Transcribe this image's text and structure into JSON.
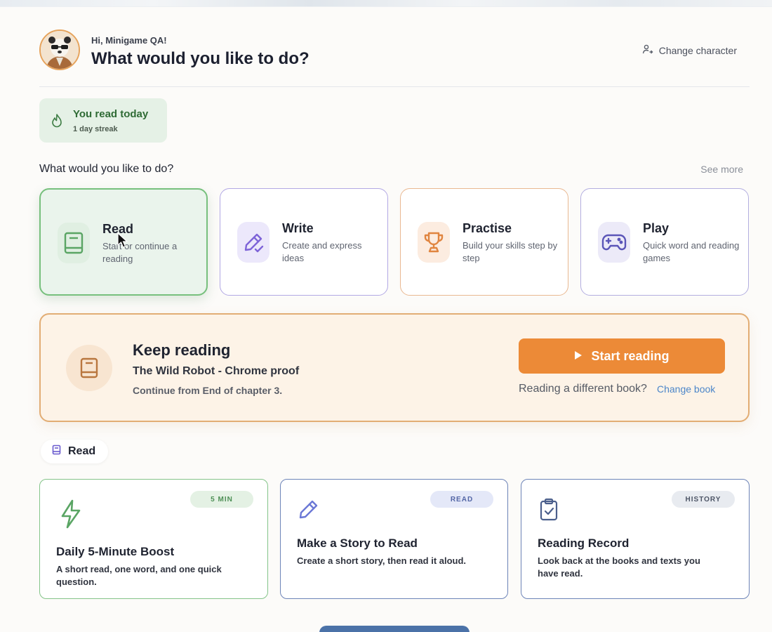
{
  "header": {
    "greeting": "Hi, Minigame QA!",
    "title": "What would you like to do?",
    "change_character": "Change character"
  },
  "streak": {
    "title": "You read today",
    "subtitle": "1 day streak"
  },
  "activities": {
    "section_title": "What would you like to do?",
    "see_more": "See more",
    "items": [
      {
        "title": "Read",
        "desc": "Start or continue a reading",
        "icon": "book-icon",
        "color": "#5aa564"
      },
      {
        "title": "Write",
        "desc": "Create and express ideas",
        "icon": "pencil-icon",
        "color": "#7e64d8"
      },
      {
        "title": "Practise",
        "desc": "Build your skills step by step",
        "icon": "trophy-icon",
        "color": "#e08540"
      },
      {
        "title": "Play",
        "desc": "Quick word and reading games",
        "icon": "gamepad-icon",
        "color": "#5b55b8"
      }
    ]
  },
  "keep_reading": {
    "title": "Keep reading",
    "book": "The Wild Robot - Chrome proof",
    "progress": "Continue from End of chapter 3.",
    "start_button": "Start reading",
    "different_book": "Reading a different book?",
    "change_book": "Change book"
  },
  "read_section": {
    "chip_label": "Read",
    "cards": [
      {
        "badge": "5 MIN",
        "title": "Daily 5-Minute Boost",
        "desc": "A short read, one word, and one quick question.",
        "icon": "lightning-icon"
      },
      {
        "badge": "READ",
        "title": "Make a Story to Read",
        "desc": "Create a short story, then read it aloud.",
        "icon": "pencil-icon"
      },
      {
        "badge": "HISTORY",
        "title": "Reading Record",
        "desc": "Look back at the books and texts you have read.",
        "icon": "clipboard-check-icon"
      }
    ]
  },
  "colors": {
    "accent_orange": "#ec8a37",
    "streak_green": "#2f6b35",
    "link_blue": "#4c86c9"
  }
}
